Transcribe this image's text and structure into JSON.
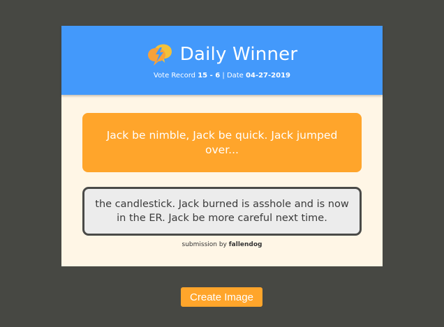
{
  "header": {
    "title": "Daily Winner",
    "vote_record_label": "Vote Record",
    "vote_record_value": "15 - 6",
    "separator": "|",
    "date_label": "Date",
    "date_value": "04-27-2019",
    "logo_icon": "speech-bubbles-lightning-icon"
  },
  "prompt": {
    "text": "Jack be nimble, Jack be quick. Jack jumped over..."
  },
  "answer": {
    "text": "the candlestick. Jack burned is asshole and is now in the ER. Jack be more careful next time."
  },
  "submission": {
    "prefix": "submission by",
    "author": "fallendog"
  },
  "actions": {
    "create_image_label": "Create Image"
  },
  "colors": {
    "background": "#474843",
    "header_blue": "#4399fb",
    "card_cream": "#fff6e6",
    "accent_orange": "#ffa52b",
    "answer_gray": "#ececec"
  }
}
